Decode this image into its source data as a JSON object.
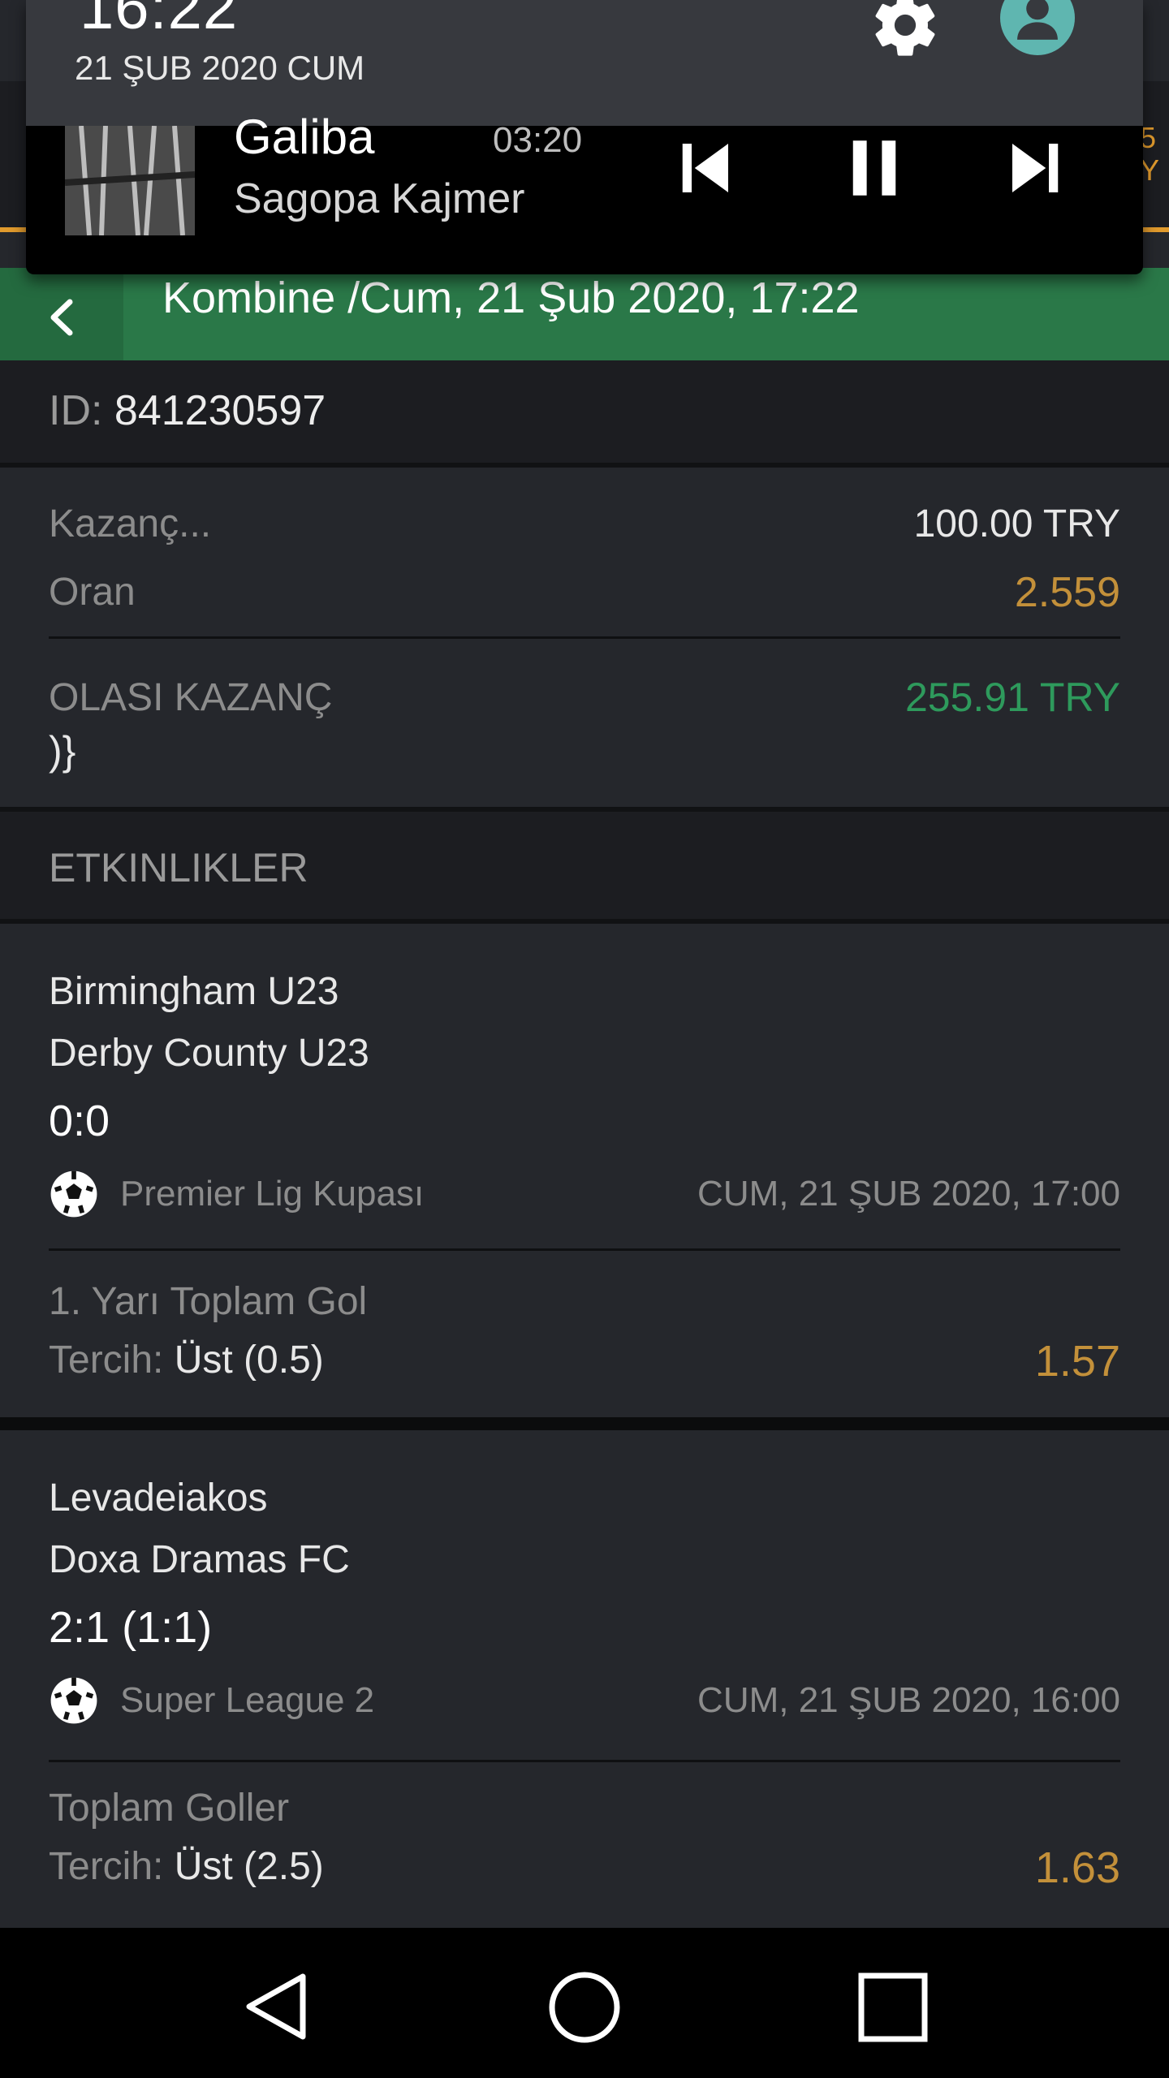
{
  "notification": {
    "clock": "16:22",
    "date": "21 ŞUB 2020 CUM",
    "media": {
      "title": "Galiba",
      "time": "03:20",
      "artist": "Sagopa Kajmer"
    }
  },
  "app_peek": {
    "text": "5\nY"
  },
  "header": {
    "title": "Kombine /Cum, 21 Şub 2020, 17:22"
  },
  "bet": {
    "id_label": "ID:",
    "id_value": "841230597",
    "stake_label": "Kazanç...",
    "stake_value": "100.00 TRY",
    "odds_label": "Oran",
    "odds_value": "2.559",
    "potential_label": "OLASI KAZANÇ",
    "potential_value": "255.91 TRY",
    "stray_text": ")}"
  },
  "events_header": "ETKINLIKLER",
  "events": [
    {
      "home": "Birmingham U23",
      "away": "Derby County U23",
      "score": "0:0",
      "league": "Premier Lig Kupası",
      "datetime": "CUM, 21 ŞUB 2020, 17:00",
      "market": "1. Yarı Toplam Gol",
      "choice_label": "Tercih:",
      "choice": "Üst (0.5)",
      "odds": "1.57"
    },
    {
      "home": "Levadeiakos",
      "away": "Doxa Dramas FC",
      "score": "2:1 (1:1)",
      "league": "Super League 2",
      "datetime": "CUM, 21 ŞUB 2020, 16:00",
      "market": "Toplam Goller",
      "choice_label": "Tercih:",
      "choice": "Üst (2.5)",
      "odds": "1.63"
    }
  ],
  "colors": {
    "green_header": "#2a7848",
    "orange_odds": "#c3903a",
    "green_win": "#2e9a5c",
    "background": "#25272c"
  },
  "icons": [
    "settings-icon",
    "user-icon",
    "previous-track-icon",
    "pause-icon",
    "next-track-icon",
    "back-chevron-icon",
    "soccer-ball-icon",
    "nav-back-icon",
    "nav-home-icon",
    "nav-recents-icon"
  ]
}
